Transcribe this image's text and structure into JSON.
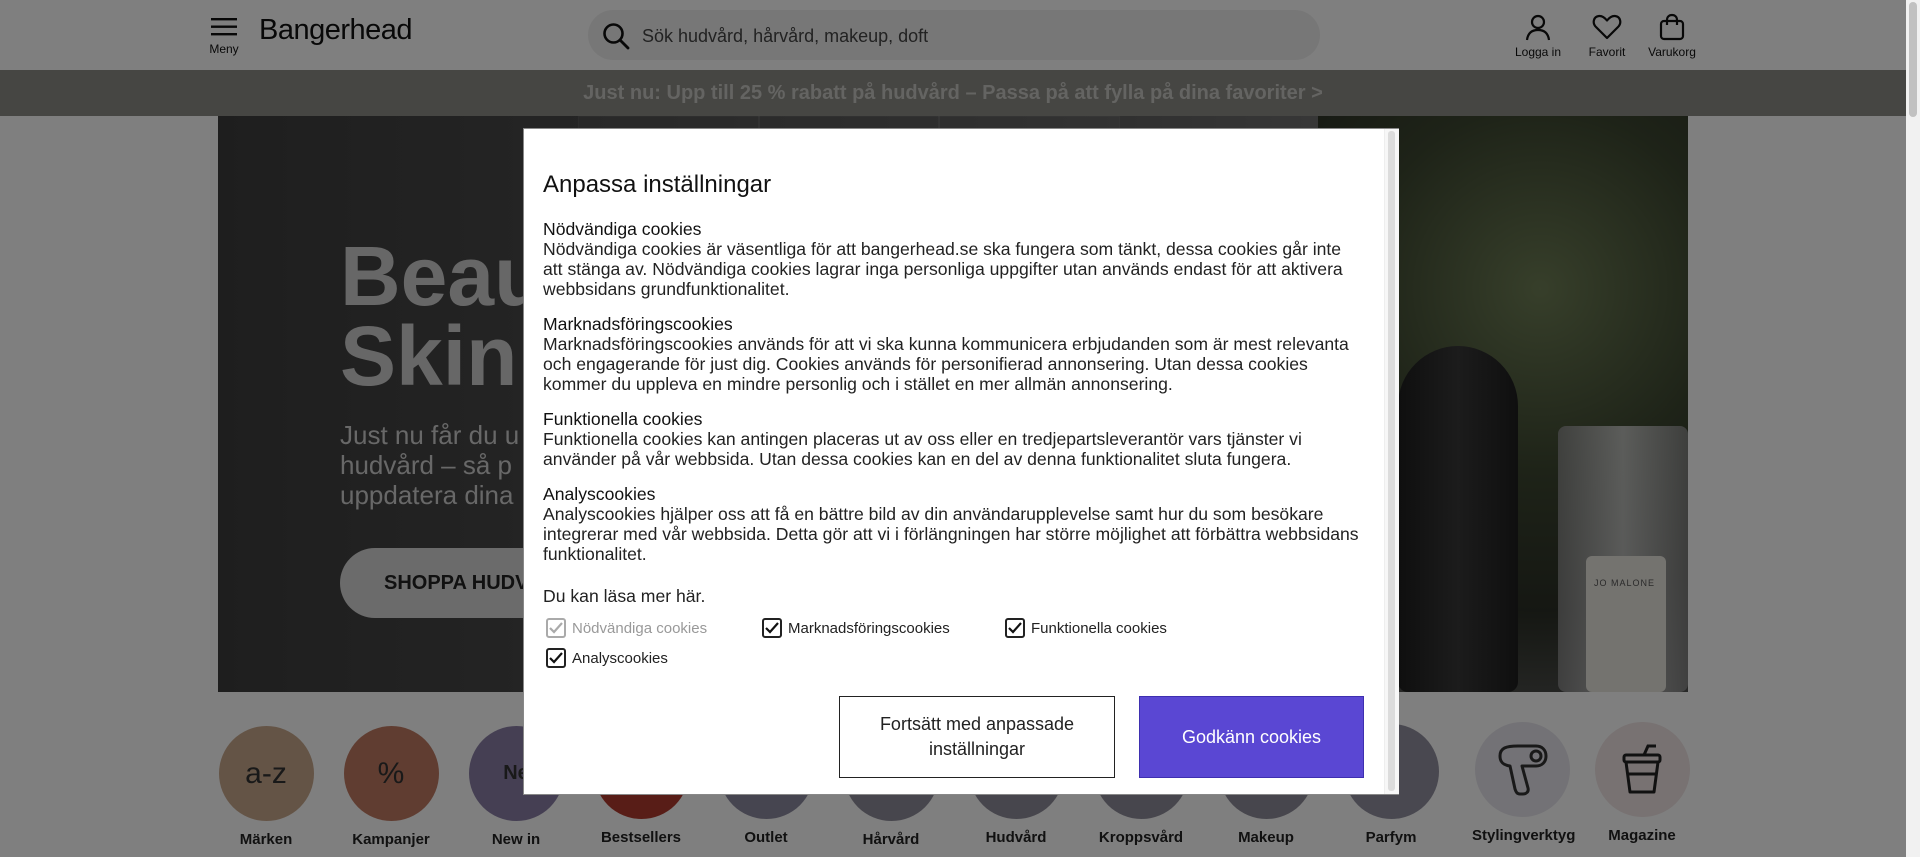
{
  "header": {
    "menu_label": "Meny",
    "logo": "Bangerhead",
    "search_placeholder": "Sök hudvård, hårvård, makeup, doft",
    "login_label": "Logga in",
    "favorites_label": "Favorit",
    "cart_label": "Varukorg"
  },
  "promo": {
    "text": "Just nu: Upp till 25 % rabatt på hudvård – Passa på att fylla på dina favoriter >"
  },
  "hero": {
    "title_line1": "Beau",
    "title_line2": "Skin",
    "text_line1": "Just nu får du u",
    "text_line2": "hudvård – så p",
    "text_line3": "uppdatera dina",
    "cta_label": "SHOPPA HUDV",
    "bottle_label": "JO MALONE"
  },
  "categories": [
    {
      "label": "Märken",
      "icon_text": "a-z",
      "color": "#c9a98d"
    },
    {
      "label": "Kampanjer",
      "icon_text": "%",
      "color": "#c07a63"
    },
    {
      "label": "New in",
      "icon_text": "Ne",
      "color": "#8b7fa6"
    },
    {
      "label": "Bestsellers",
      "icon_text": "",
      "color": "#b13b2e"
    },
    {
      "label": "Outlet",
      "icon_text": "",
      "color": "#8d8ba0"
    },
    {
      "label": "Hårvård",
      "icon_text": "",
      "color": "#8f8d9a"
    },
    {
      "label": "Hudvård",
      "icon_text": "",
      "color": "#8f8d9a"
    },
    {
      "label": "Kroppsvård",
      "icon_text": "",
      "color": "#8f8d9a"
    },
    {
      "label": "Makeup",
      "icon_text": "",
      "color": "#8f8d9a"
    },
    {
      "label": "Parfym",
      "icon_text": "",
      "color": "#9290a0"
    },
    {
      "label": "Stylingverktyg",
      "icon_text": "",
      "color": "#e6e5ec"
    },
    {
      "label": "Magazine",
      "icon_text": "",
      "color": "#f0e4e4"
    }
  ],
  "cookie_modal": {
    "title": "Anpassa inställningar",
    "sections": [
      {
        "title": "Nödvändiga cookies",
        "body": "Nödvändiga cookies är väsentliga för att bangerhead.se ska fungera som tänkt, dessa cookies går inte att stänga av. Nödvändiga cookies lagrar inga personliga uppgifter utan används endast för att aktivera webbsidans grundfunktionalitet."
      },
      {
        "title": "Marknadsföringscookies",
        "body": "Marknadsföringscookies används för att vi ska kunna kommunicera erbjudanden som är mest relevanta och engagerande för just dig. Cookies används för personifierad annonsering. Utan dessa cookies kommer du uppleva en mindre personlig och i stället en mer allmän annonsering."
      },
      {
        "title": "Funktionella cookies",
        "body": "Funktionella cookies kan antingen placeras ut av oss eller en tredjepartsleverantör vars tjänster vi använder på vår webbsida. Utan dessa cookies kan en del av denna funktionalitet sluta fungera."
      },
      {
        "title": "Analyscookies",
        "body": "Analyscookies hjälper oss att få en bättre bild av din användarupplevelse samt hur du som besökare integrerar med vår webbsida. Detta gör att vi i förlängningen har större möjlighet att förbättra webbsidans funktionalitet."
      }
    ],
    "read_more": "Du kan läsa mer här.",
    "checkboxes": [
      {
        "label": "Nödvändiga cookies",
        "checked": true,
        "disabled": true
      },
      {
        "label": "Marknadsföringscookies",
        "checked": true,
        "disabled": false
      },
      {
        "label": "Funktionella cookies",
        "checked": true,
        "disabled": false
      },
      {
        "label": "Analyscookies",
        "checked": true,
        "disabled": false
      }
    ],
    "continue_button": "Fortsätt med anpassade inställningar",
    "accept_button": "Godkänn cookies",
    "accent_color": "#5a47d3"
  }
}
